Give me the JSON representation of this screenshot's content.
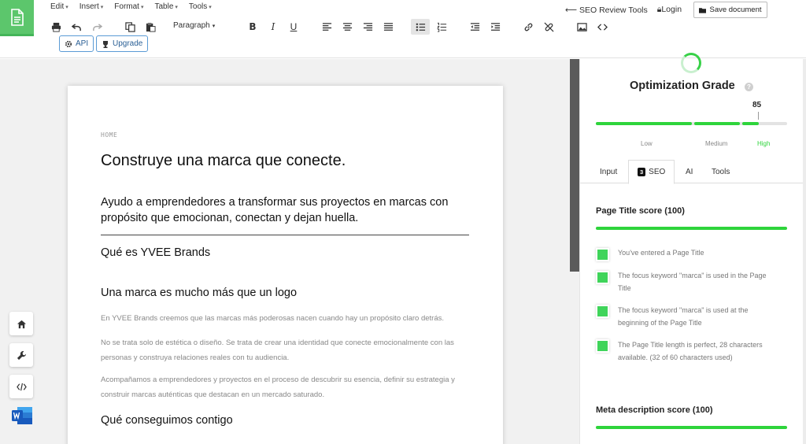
{
  "menu": {
    "items": [
      "Edit",
      "Insert",
      "Format",
      "Table",
      "Tools"
    ]
  },
  "toolbar": {
    "paragraph_label": "Paragraph",
    "api_label": "API",
    "upgrade_label": "Upgrade"
  },
  "header": {
    "seo_tools_label": "SEO Review Tools",
    "login_label": "Login",
    "save_label": "Save document"
  },
  "document": {
    "breadcrumb": "HOME",
    "title": "Construye una marca que conecte.",
    "lead": "Ayudo a emprendedores a transformar sus proyectos en marcas con propósito que emocionan, conectan y dejan huella.",
    "h2_1": "Qué es YVEE Brands",
    "h2_2": "Una marca es mucho más que un logo",
    "p1": "En YVEE Brands creemos que las marcas más poderosas nacen cuando hay un propósito claro detrás.",
    "p2": "No se trata solo de estética o diseño. Se trata de crear una identidad que conecte emocionalmente con las personas y construya relaciones reales con tu audiencia.",
    "p3": "Acompañamos a emprendedores y proyectos en el proceso de descubrir su esencia, definir su estrategia y construir marcas auténticas que destacan en un mercado saturado.",
    "h2_3": "Qué conseguimos contigo"
  },
  "panel": {
    "grade_title": "Optimization Grade",
    "help": "?",
    "score": "85",
    "score_value": 85,
    "score_max": 100,
    "low_label": "Low",
    "medium_label": "Medium",
    "high_label": "High",
    "tabs": [
      {
        "label": "Input"
      },
      {
        "label": "SEO",
        "badge": "3"
      },
      {
        "label": "AI"
      },
      {
        "label": "Tools"
      }
    ],
    "page_title_section": "Page Title score (100)",
    "checks": [
      "You've entered a Page Title",
      "The focus keyword \"marca\" is used in the Page Title",
      "The focus keyword \"marca\" is used at the beginning of the Page Title",
      "The Page Title length is perfect, 28 characters available. (32 of 60 characters used)"
    ],
    "meta_section": "Meta description score (100)"
  },
  "colors": {
    "brand_green": "#5cc66c",
    "score_green": "#2ed43b",
    "link_blue": "#2a5f95"
  }
}
